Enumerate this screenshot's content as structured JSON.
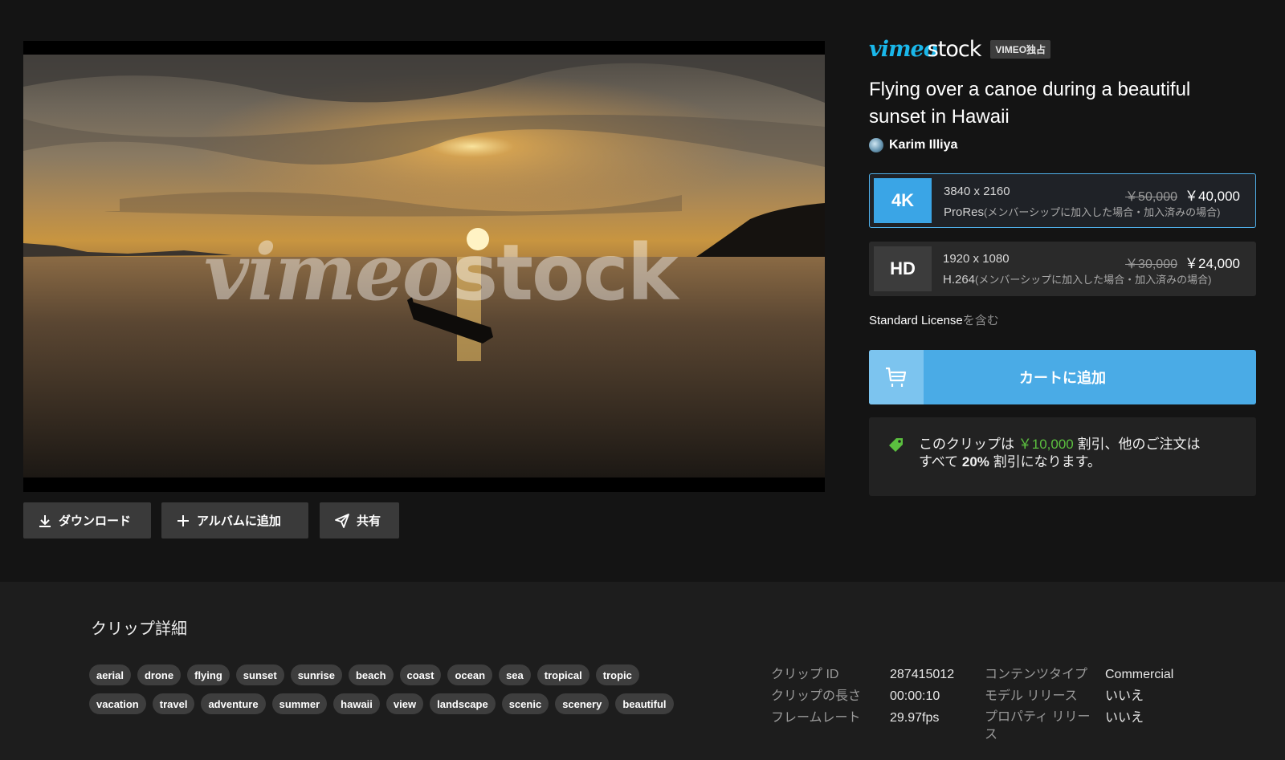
{
  "video": {
    "watermark_left": "vimeo",
    "watermark_right": "stock"
  },
  "actions": {
    "download": "ダウンロード",
    "add_album": "アルバムに追加",
    "share": "共有"
  },
  "brand": {
    "vimeo": "vimeo",
    "stock": "stock",
    "badge": "VIMEO独占"
  },
  "clip": {
    "title": "Flying over a canoe during a beautiful sunset in Hawaii",
    "author": "Karim Illiya"
  },
  "options": [
    {
      "badge": "4K",
      "resolution": "3840 x 2160",
      "codec": "ProRes",
      "note": "(メンバーシップに加入した場合・加入済みの場合)",
      "price_old": "￥50,000",
      "price_new": "￥40,000",
      "selected": true
    },
    {
      "badge": "HD",
      "resolution": "1920 x 1080",
      "codec": "H.264",
      "note": "(メンバーシップに加入した場合・加入済みの場合)",
      "price_old": "￥30,000",
      "price_new": "￥24,000",
      "selected": false
    }
  ],
  "license": {
    "name": "Standard License",
    "suffix": "を含む"
  },
  "cart": {
    "label": "カートに追加"
  },
  "promo": {
    "text1": "このクリップは ",
    "amount": "￥10,000",
    "text2": " 割引、他のご注文は",
    "text3": "すべて ",
    "percent": "20%",
    "text4": " 割引になります。"
  },
  "details": {
    "heading": "クリップ詳細",
    "tags": [
      "aerial",
      "drone",
      "flying",
      "sunset",
      "sunrise",
      "beach",
      "coast",
      "ocean",
      "sea",
      "tropical",
      "tropic",
      "vacation",
      "travel",
      "adventure",
      "summer",
      "hawaii",
      "view",
      "landscape",
      "scenic",
      "scenery",
      "beautiful"
    ],
    "meta": {
      "clip_id_label": "クリップ ID",
      "clip_id": "287415012",
      "length_label": "クリップの長さ",
      "length": "00:00:10",
      "framerate_label": "フレームレート",
      "framerate": "29.97fps",
      "content_type_label": "コンテンツタイプ",
      "content_type": "Commercial",
      "model_release_label": "モデル リリース",
      "model_release": "いいえ",
      "property_release_label": "プロパティ リリース",
      "property_release": "いいえ"
    }
  },
  "colors": {
    "accent": "#4aabe6",
    "brand_blue": "#1ab7ea",
    "discount_green": "#5bbf3f"
  }
}
